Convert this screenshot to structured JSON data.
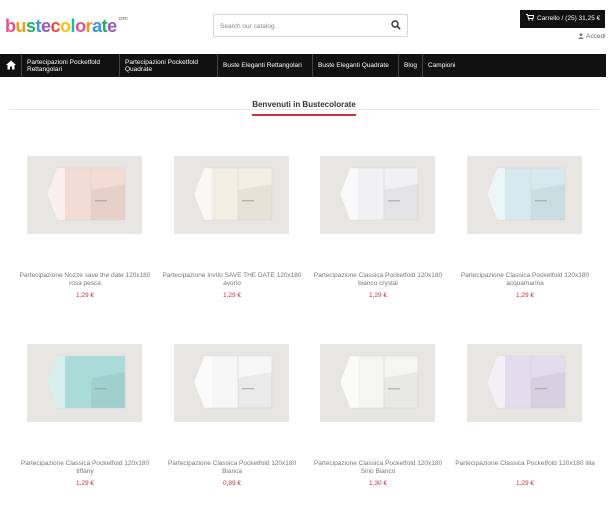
{
  "brand": {
    "logo_letters": [
      "b",
      "u",
      "s",
      "t",
      "e",
      "c",
      "o",
      "l",
      "o",
      "r",
      "a",
      "t",
      "e"
    ],
    "logo_colors": [
      "#e84e8a",
      "#f39c12",
      "#27ae60",
      "#3498db",
      "#9b59b6",
      "#e74c3c",
      "#f1c40f",
      "#1abc9c",
      "#e84e8a",
      "#f39c12",
      "#3498db",
      "#27ae60",
      "#9b59b6"
    ],
    "tld": ".com"
  },
  "search": {
    "placeholder": "Search our catalog",
    "icon": "search-icon"
  },
  "cart": {
    "label": "Carrello / (25) 31,25 €",
    "icon": "shopping-cart-icon"
  },
  "account": {
    "login_label": "Accedi",
    "icon": "user-icon"
  },
  "nav": {
    "home_icon": "home-icon",
    "items": [
      "Partecipazioni Pocketfold Rettangolari",
      "Partecipazioni Pocketfold Quadrate",
      "Buste Eleganti Rettangolari",
      "Buste Eleganti Quadrate",
      "Blog",
      "Campioni"
    ]
  },
  "section_title": "Benvenuti in Bustecolorate",
  "products": [
    {
      "name": "Partecipazione Nozze save the date 120x180 rosa pesca",
      "price": "1,29 €",
      "tint": "#f3dcd4"
    },
    {
      "name": "Partecipazione Invito SAVE THE DATE 120x180 avorio",
      "price": "1,29 €",
      "tint": "#f4efe4"
    },
    {
      "name": "Partecipazione Classica Pocketfold 120x180 bianco crystal",
      "price": "1,29 €",
      "tint": "#f1f1f4"
    },
    {
      "name": "Partecipazione Classica Pocketfold 120x180 acquamarina",
      "price": "1,29 €",
      "tint": "#d5e9ee"
    },
    {
      "name": "Partecipazione Classica Pocketfold 120x180 tiffany",
      "price": "1,29 €",
      "tint": "#a9dcd8"
    },
    {
      "name": "Partecipazione Classica Pocketfold 120x180 Bianca",
      "price": "0,89 €",
      "tint": "#f7f7f7"
    },
    {
      "name": "Partecipazione Classica Pocketfold 120x180 Sirio Bianco",
      "price": "1,30 €",
      "tint": "#f5f5f3"
    },
    {
      "name": "Partecipazione Classica Pocketfold 120x180 lilla",
      "price": "1,29 €",
      "tint": "#e3dcee"
    }
  ],
  "colors": {
    "accent": "#c6323b",
    "nav_bg": "#111111"
  }
}
